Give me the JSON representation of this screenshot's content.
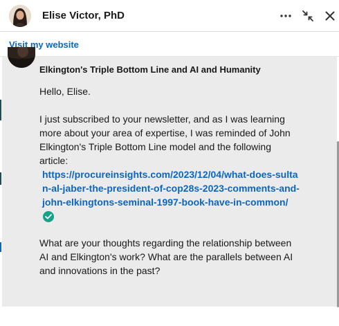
{
  "header": {
    "name": "Elise Victor, PhD",
    "more_icon": "more-horizontal-icon",
    "minimize_icon": "collapse-arrows-icon",
    "close_icon": "close-icon"
  },
  "subbar": {
    "website_link": "Visit my website"
  },
  "message": {
    "subject": "Elkington's Triple Bottom Line and AI and Humanity",
    "greeting": "Hello, Elise.",
    "paragraph1": "I just subscribed to your newsletter, and as I was learning more about your area of expertise, I was reminded of John Elkington's Triple Bottom Line model and the following article:",
    "link": "https://procureinsights.com/2023/12/04/what-does-sultan-al-jaber-the-president-of-cop28s-2023-comments-and-john-elkingtons-seminal-1997-book-have-in-common/",
    "verified_icon": "check-circle-icon",
    "paragraph2": "What are your thoughts regarding the relationship between AI and Elkington's work? What are the parallels between AI and innovations in the past?"
  },
  "colors": {
    "link": "#0a66c2",
    "bubble_bg": "#ebebeb",
    "check_green": "#13a388"
  }
}
